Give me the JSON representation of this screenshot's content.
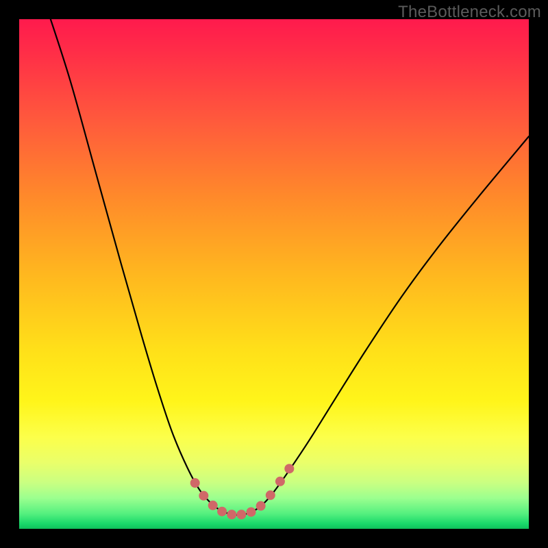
{
  "watermark": "TheBottleneck.com",
  "colors": {
    "background": "#000000",
    "curve": "#000000",
    "marker_fill": "#d06868",
    "marker_stroke": "#d06868"
  },
  "chart_data": {
    "type": "line",
    "title": "",
    "xlabel": "",
    "ylabel": "",
    "xlim": [
      0,
      100
    ],
    "ylim": [
      0,
      100
    ],
    "note": "Values are read in plot-area percent coordinates (x% from left, y% from top). The visible curve is a steep V/valley shape.",
    "series": [
      {
        "name": "bottleneck-curve",
        "points": [
          {
            "x": 5.5,
            "y": -2
          },
          {
            "x": 10,
            "y": 12
          },
          {
            "x": 15,
            "y": 30
          },
          {
            "x": 20,
            "y": 48
          },
          {
            "x": 24,
            "y": 62
          },
          {
            "x": 27,
            "y": 72
          },
          {
            "x": 30,
            "y": 81
          },
          {
            "x": 33,
            "y": 88
          },
          {
            "x": 35.5,
            "y": 92.5
          },
          {
            "x": 38,
            "y": 95.3
          },
          {
            "x": 40,
            "y": 96.6
          },
          {
            "x": 42,
            "y": 97.2
          },
          {
            "x": 44,
            "y": 97.2
          },
          {
            "x": 46,
            "y": 96.5
          },
          {
            "x": 48,
            "y": 95
          },
          {
            "x": 50,
            "y": 92.7
          },
          {
            "x": 53,
            "y": 88.5
          },
          {
            "x": 57,
            "y": 82.5
          },
          {
            "x": 62,
            "y": 74.5
          },
          {
            "x": 68,
            "y": 65
          },
          {
            "x": 75,
            "y": 54.5
          },
          {
            "x": 82,
            "y": 45
          },
          {
            "x": 90,
            "y": 35
          },
          {
            "x": 100,
            "y": 23
          }
        ]
      }
    ],
    "markers": {
      "name": "highlight-range",
      "shape": "rounded-square",
      "points": [
        {
          "x": 34.5,
          "y": 91
        },
        {
          "x": 36.2,
          "y": 93.5
        },
        {
          "x": 38,
          "y": 95.4
        },
        {
          "x": 39.8,
          "y": 96.6
        },
        {
          "x": 41.7,
          "y": 97.2
        },
        {
          "x": 43.6,
          "y": 97.2
        },
        {
          "x": 45.5,
          "y": 96.7
        },
        {
          "x": 47.4,
          "y": 95.5
        },
        {
          "x": 49.3,
          "y": 93.4
        },
        {
          "x": 51.2,
          "y": 90.7
        },
        {
          "x": 53.0,
          "y": 88.2
        }
      ]
    }
  }
}
